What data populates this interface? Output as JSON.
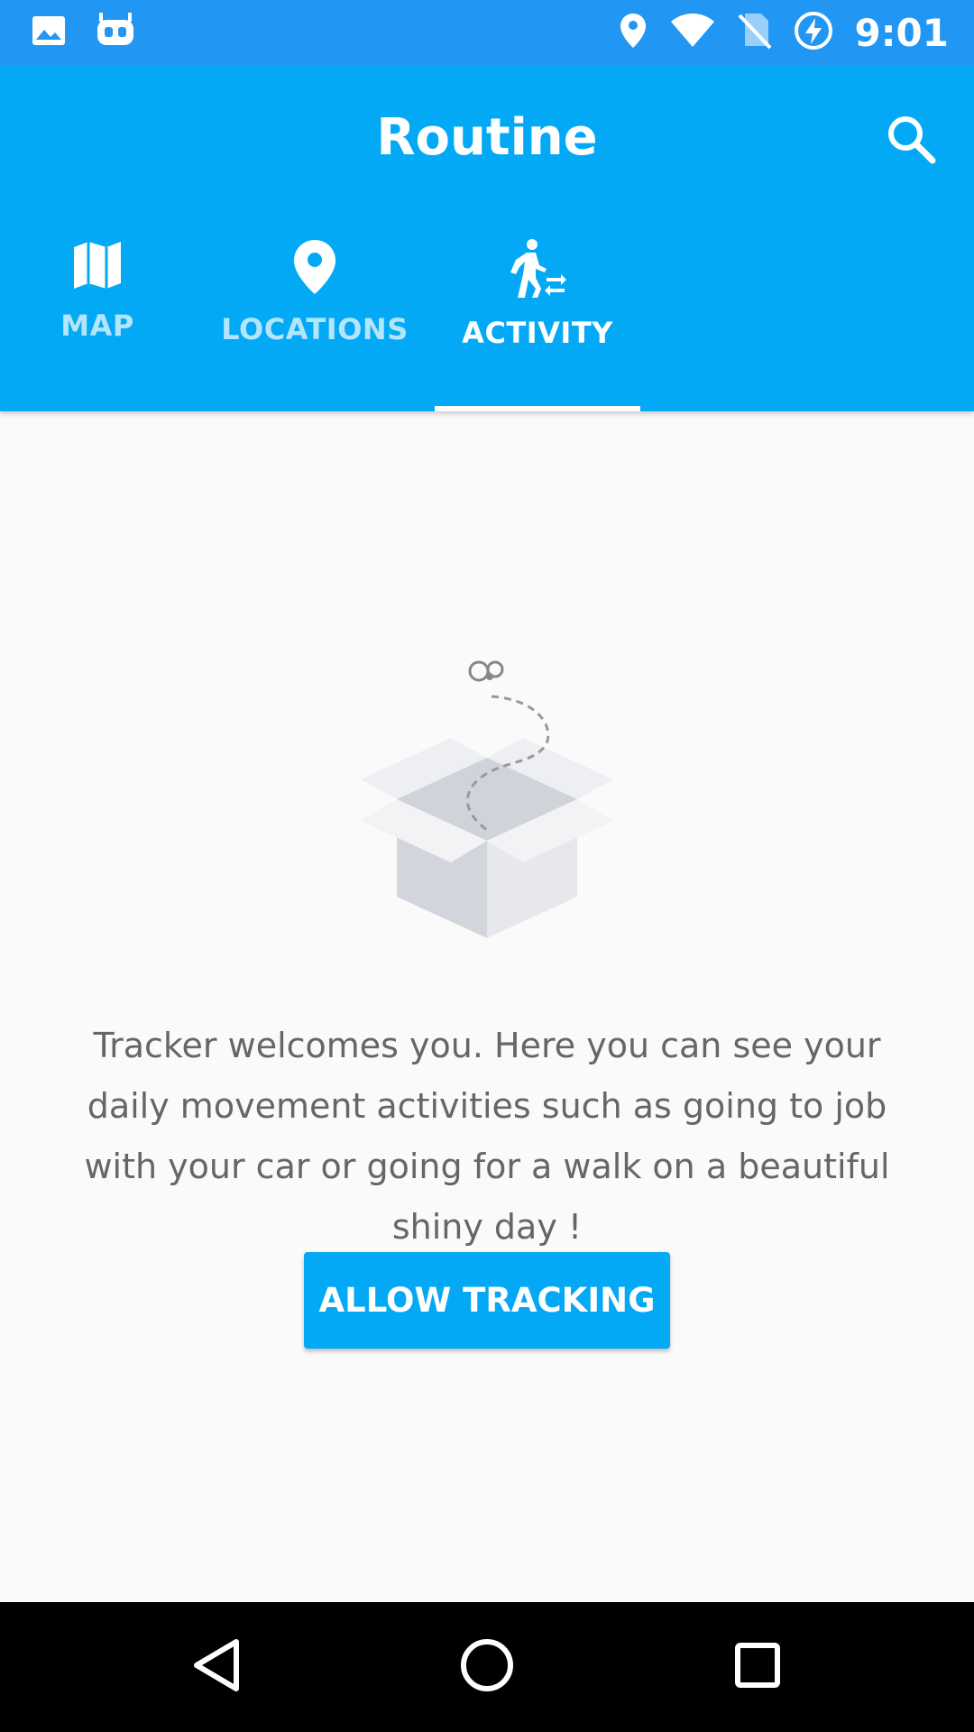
{
  "status_bar": {
    "time": "9:01",
    "left_icons": [
      "image-icon",
      "cyanogen-robot-icon"
    ],
    "right_icons": [
      "location-pin-icon",
      "wifi-icon",
      "no-sim-icon",
      "battery-charging-icon"
    ]
  },
  "header": {
    "title": "Routine",
    "search_icon": "search-icon"
  },
  "tabs": [
    {
      "label": "MAP",
      "icon": "map-icon",
      "active": false
    },
    {
      "label": "LOCATIONS",
      "icon": "location-pin-icon",
      "active": false
    },
    {
      "label": "ACTIVITY",
      "icon": "walking-activity-icon",
      "active": true
    }
  ],
  "empty_state": {
    "illustration": "open-box-illustration",
    "message": "Tracker welcomes you. Here you can see your daily movement activities such as going to job with your car or going for a walk on a beautiful shiny day !",
    "button_label": "ALLOW TRACKING"
  },
  "colors": {
    "status_bar": "#2196f3",
    "primary": "#03a9f4",
    "background": "#fafafa",
    "inactive_tab_text": "#b3e5fc"
  },
  "nav_bar": {
    "buttons": [
      "back-icon",
      "home-icon",
      "recents-icon"
    ]
  }
}
